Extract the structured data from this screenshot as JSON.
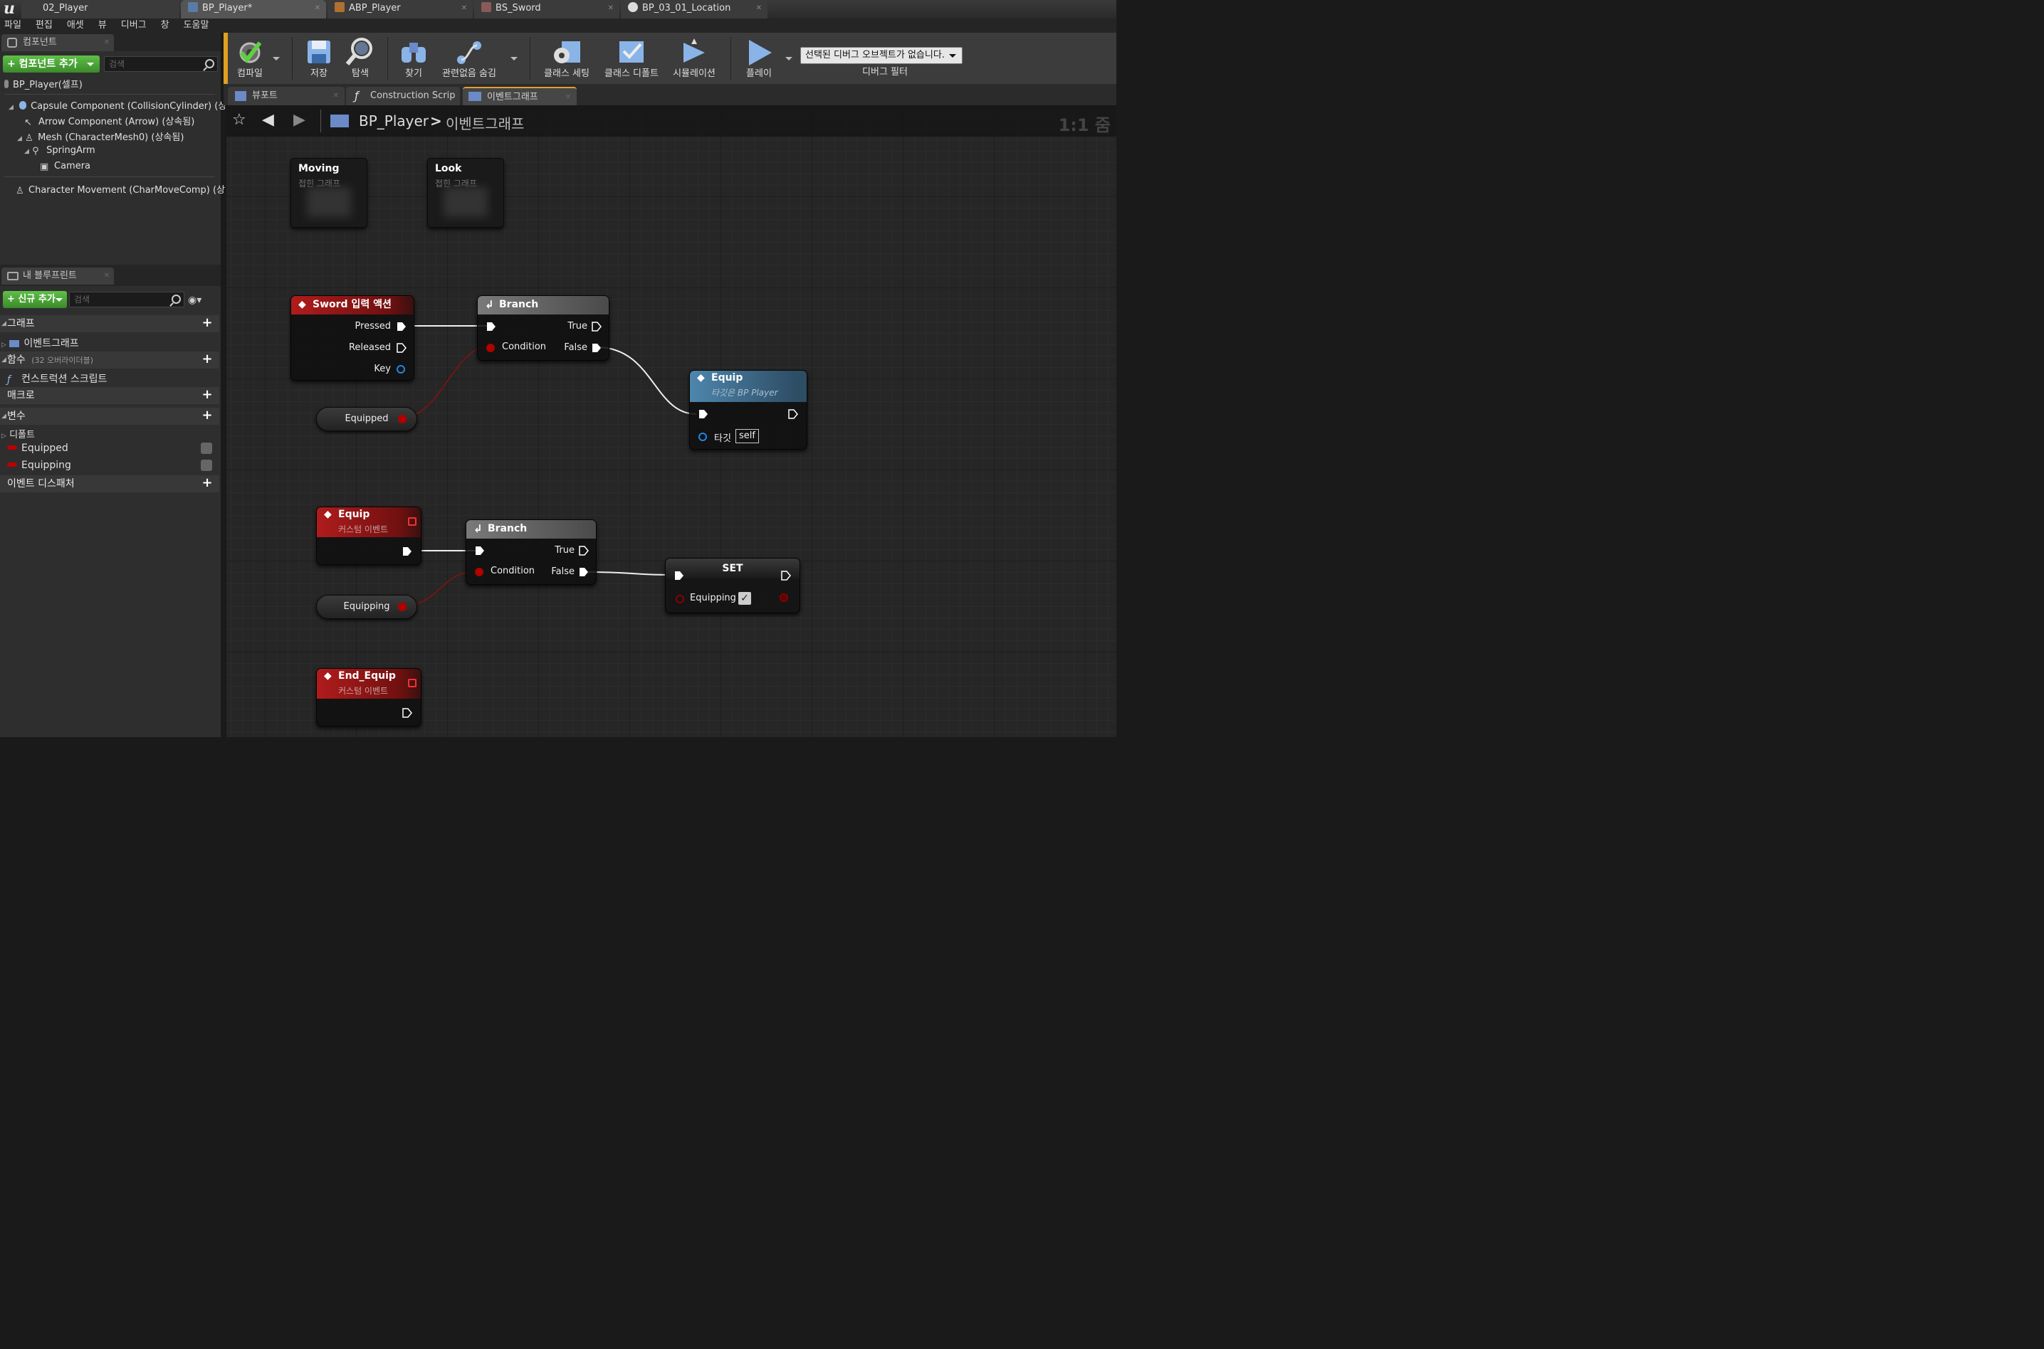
{
  "app": {
    "logo": "u"
  },
  "doc_tabs": [
    {
      "label": "02_Player",
      "active": false
    },
    {
      "label": "BP_Player*",
      "active": true
    },
    {
      "label": "ABP_Player",
      "active": false
    },
    {
      "label": "BS_Sword",
      "active": false
    },
    {
      "label": "BP_03_01_Location",
      "active": false
    }
  ],
  "menu": [
    "파일",
    "편집",
    "애셋",
    "뷰",
    "디버그",
    "창",
    "도움말"
  ],
  "components_panel": {
    "tab": "컴포넌트",
    "add_button": "+ 컴포넌트 추가",
    "search_placeholder": "검색",
    "root": "BP_Player(셀프)",
    "items": [
      "Capsule Component (CollisionCylinder) (상속",
      "Arrow Component (Arrow) (상속됨)",
      "Mesh (CharacterMesh0) (상속됨)",
      "SpringArm",
      "Camera",
      "Character Movement (CharMoveComp) (상속"
    ]
  },
  "my_blueprint": {
    "tab": "내 블루프린트",
    "add_button": "+ 신규 추가",
    "search_placeholder": "검색",
    "sections": {
      "graph": "그래프",
      "graph_item": "이벤트그래프",
      "functions": "함수",
      "functions_note": "(32 오버라이더블)",
      "functions_item": "컨스트럭션 스크립트",
      "macros": "매크로",
      "variables": "변수",
      "default_category": "디폴트",
      "variables_items": [
        "Equipped",
        "Equipping"
      ],
      "dispatchers": "이벤트 디스패처"
    }
  },
  "toolbar": {
    "buttons": [
      "컴파일",
      "저장",
      "탐색",
      "찾기",
      "관련없음 숨김",
      "클래스 세팅",
      "클래스 디폴트",
      "시뮬레이션",
      "플레이"
    ],
    "debug_select": "선택된 디버그 오브젝트가 없습니다.",
    "debug_filter": "디버그 필터"
  },
  "graph_tabs": [
    "뷰포트",
    "Construction Scrip",
    "이벤트그래프"
  ],
  "graph": {
    "breadcrumb_root": "BP_Player",
    "breadcrumb_sep": ">",
    "breadcrumb_current": "이벤트그래프",
    "zoom": "1:1 줌",
    "collapsed_nodes": [
      {
        "title": "Moving",
        "subtitle": "접힌 그래프"
      },
      {
        "title": "Look",
        "subtitle": "접힌 그래프"
      }
    ],
    "nodes": {
      "sword_action": {
        "title": "Sword 입력 액션",
        "pins": [
          "Pressed",
          "Released",
          "Key"
        ]
      },
      "branch1": {
        "title": "Branch",
        "condition": "Condition",
        "true": "True",
        "false": "False"
      },
      "equipped_var": "Equipped",
      "equip_call": {
        "title": "Equip",
        "subtitle": "타깃은 BP Player",
        "target": "타깃",
        "target_value": "self"
      },
      "equip_event": {
        "title": "Equip",
        "subtitle": "커스텀 이벤트"
      },
      "branch2": {
        "title": "Branch",
        "condition": "Condition",
        "true": "True",
        "false": "False"
      },
      "equipping_var": "Equipping",
      "set_node": {
        "title": "SET",
        "var": "Equipping"
      },
      "end_equip_event": {
        "title": "End_Equip",
        "subtitle": "커스텀 이벤트"
      }
    }
  },
  "colors": {
    "event_red": "#a01818",
    "function_blue": "#3f6d8a",
    "bool_pin": "#a00000",
    "exec_pin": "#ffffff",
    "struct_pin": "#1e88e5",
    "accent_green": "#4caf3a"
  }
}
